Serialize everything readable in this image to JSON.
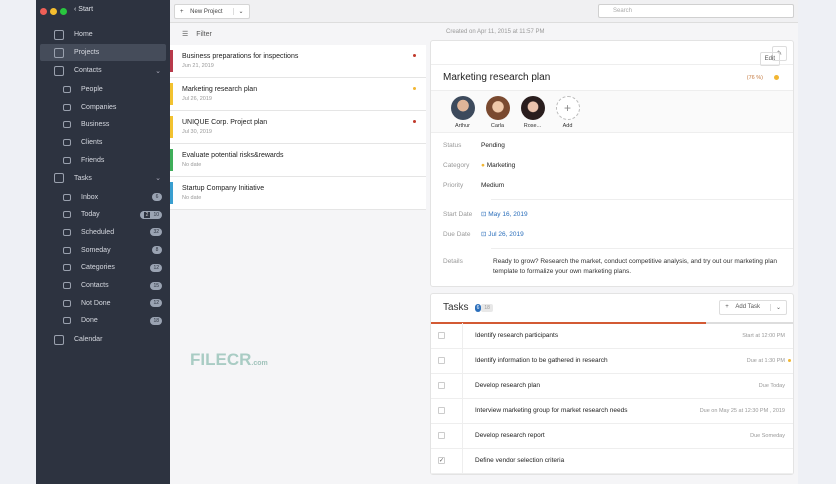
{
  "sidebar": {
    "back_label": "Start",
    "items": [
      {
        "label": "Home"
      },
      {
        "label": "Projects"
      },
      {
        "label": "Contacts"
      },
      {
        "label": "People"
      },
      {
        "label": "Companies"
      },
      {
        "label": "Business"
      },
      {
        "label": "Clients"
      },
      {
        "label": "Friends"
      },
      {
        "label": "Tasks"
      },
      {
        "label": "Inbox",
        "count": "6"
      },
      {
        "label": "Today",
        "count": "10",
        "extra": "2"
      },
      {
        "label": "Scheduled",
        "count": "32"
      },
      {
        "label": "Someday",
        "count": "8"
      },
      {
        "label": "Categories",
        "count": "12"
      },
      {
        "label": "Contacts",
        "count": "15"
      },
      {
        "label": "Not Done",
        "count": "12"
      },
      {
        "label": "Done",
        "count": "18"
      },
      {
        "label": "Calendar"
      }
    ]
  },
  "toolbar": {
    "new_project": "New Project",
    "search_placeholder": "Search"
  },
  "list": {
    "filter": "Filter",
    "projects": [
      {
        "title": "Business preparations for inspections",
        "date": "Jun 21, 2019",
        "color": "#b83a4b",
        "dot": "#c0392b"
      },
      {
        "title": "Marketing research plan",
        "date": "Jul 26, 2019",
        "color": "#f2c230",
        "dot": "#f2b632"
      },
      {
        "title": "UNIQUE Corp. Project plan",
        "date": "Jul 30, 2019",
        "color": "#f2c230",
        "dot": "#c0392b"
      },
      {
        "title": "Evaluate potential risks&rewards",
        "date": "No date",
        "color": "#3fae5a",
        "dot": ""
      },
      {
        "title": "Startup Company Initiative",
        "date": "No date",
        "color": "#3a9fd0",
        "dot": ""
      }
    ]
  },
  "detail": {
    "created": "Created on Apr 11, 2015 at 11:57 PM",
    "edit": "Edit",
    "title": "Marketing research plan",
    "percent": "(76 %)",
    "people": [
      {
        "name": "Arthur"
      },
      {
        "name": "Carla"
      },
      {
        "name": "Rose..."
      }
    ],
    "add": "Add",
    "status_label": "Status",
    "status": "Pending",
    "category_label": "Category",
    "category": "Marketing",
    "priority_label": "Priority",
    "priority": "Medium",
    "start_label": "Start Date",
    "start": "May 16, 2019",
    "due_label": "Due Date",
    "due": "Jul 26, 2019",
    "details_label": "Details",
    "details": "Ready to grow? Research the market, conduct competitive analysis, and try out our marketing plan template to formalize your own marketing plans."
  },
  "tasks": {
    "title": "Tasks",
    "badge": "6",
    "total": "18",
    "add": "Add Task",
    "progress": 0.76,
    "items": [
      {
        "name": "Identify research participants",
        "due": "Start at 12:00 PM",
        "checked": false
      },
      {
        "name": "Identify information to be gathered in research",
        "due": "Due at 1:30 PM",
        "checked": false,
        "star": true
      },
      {
        "name": "Develop research plan",
        "due": "Due Today",
        "checked": false
      },
      {
        "name": "Interview marketing group for market research needs",
        "due": "Due on May 25 at 12:30 PM , 2019",
        "checked": false
      },
      {
        "name": "Develop research report",
        "due": "Due Someday",
        "checked": false
      },
      {
        "name": "Define vendor selection criteria",
        "due": "",
        "checked": true
      }
    ]
  },
  "watermark": {
    "brand": "FILECR",
    "tld": ".com"
  }
}
